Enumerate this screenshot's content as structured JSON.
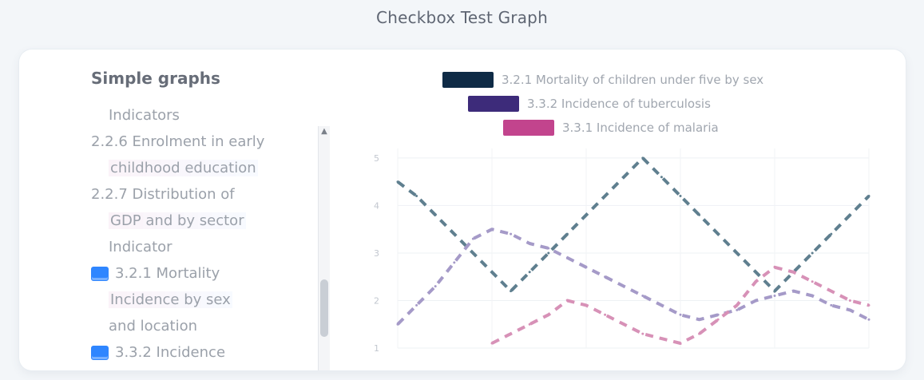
{
  "title": "Checkbox Test Graph",
  "sidebar": {
    "heading": "Simple graphs",
    "items": [
      {
        "label": "Indicators",
        "checked": false,
        "indent": 1
      },
      {
        "label": "2.2.6 Enrolment in early",
        "checked": false,
        "indent": 0
      },
      {
        "label": "childhood education",
        "checked": false,
        "indent": 1
      },
      {
        "label": "2.2.7 Distribution of",
        "checked": false,
        "indent": 0
      },
      {
        "label": "GDP and by sector",
        "checked": false,
        "indent": 1
      },
      {
        "label": "Indicator",
        "checked": false,
        "indent": 1
      },
      {
        "label": "3.2.1 Mortality",
        "checked": true,
        "indent": 0
      },
      {
        "label": "Incidence by sex",
        "checked": false,
        "indent": 1
      },
      {
        "label": "and location",
        "checked": false,
        "indent": 1
      },
      {
        "label": "3.3.2 Incidence",
        "checked": true,
        "indent": 0
      }
    ]
  },
  "colors": {
    "page_bg": "#f3f6f9",
    "card_bg": "#ffffff",
    "accent": "#2f86ff",
    "series_1": "#0f2b46",
    "series_2": "#3d2b7a",
    "series_3": "#c2448d"
  },
  "chart_data": {
    "type": "line",
    "x": [
      0,
      1,
      2,
      3,
      4,
      5,
      6,
      7,
      8,
      9,
      10,
      11,
      12,
      13,
      14,
      15,
      16,
      17,
      18,
      19,
      20,
      21,
      22,
      23,
      24,
      25
    ],
    "series": [
      {
        "name": "3.2.1 Mortality of children under five by sex",
        "color": "#5f7f8f",
        "values": [
          4.5,
          4.2,
          3.8,
          3.4,
          3.0,
          2.6,
          2.2,
          2.6,
          3.0,
          3.4,
          3.8,
          4.2,
          4.6,
          5.0,
          4.6,
          4.2,
          3.8,
          3.4,
          3.0,
          2.6,
          2.2,
          2.6,
          3.0,
          3.4,
          3.8,
          4.2
        ]
      },
      {
        "name": "3.3.2 Incidence of tuberculosis",
        "color": "#a59ac8",
        "values": [
          1.5,
          1.9,
          2.3,
          2.8,
          3.3,
          3.5,
          3.4,
          3.2,
          3.1,
          2.9,
          2.7,
          2.5,
          2.3,
          2.1,
          1.9,
          1.7,
          1.6,
          1.7,
          1.8,
          2.0,
          2.1,
          2.2,
          2.1,
          1.9,
          1.8,
          1.6
        ]
      },
      {
        "name": "3.3.1 Incidence of malaria",
        "color": "#d791b7",
        "values": [
          null,
          null,
          null,
          null,
          null,
          1.1,
          1.3,
          1.5,
          1.7,
          2.0,
          1.9,
          1.7,
          1.5,
          1.3,
          1.2,
          1.1,
          1.3,
          1.6,
          1.9,
          2.4,
          2.7,
          2.6,
          2.4,
          2.2,
          2.0,
          1.9
        ]
      }
    ],
    "ylim": [
      1,
      5.2
    ],
    "xlim": [
      0,
      25
    ],
    "grid": true,
    "legend_placement": "top-center",
    "yticks": [
      "5",
      "4",
      "3",
      "2",
      "1"
    ]
  }
}
